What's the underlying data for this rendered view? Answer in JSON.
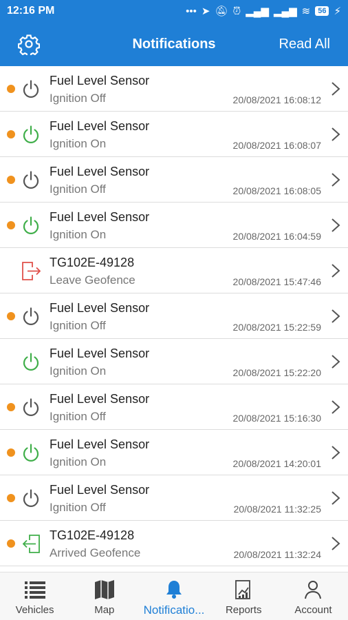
{
  "status_bar": {
    "time": "12:16 PM",
    "icons": [
      "more-dots-icon",
      "location-icon",
      "mute-icon",
      "alarm-icon",
      "signal-icon",
      "signal-icon",
      "wifi-icon"
    ],
    "battery": "56",
    "charging": "⚡"
  },
  "header": {
    "title": "Notifications",
    "action": "Read All"
  },
  "notifications": [
    {
      "unread": true,
      "type": "ignition-off",
      "title": "Fuel Level Sensor",
      "subtitle": "Ignition Off",
      "time": "20/08/2021 16:08:12"
    },
    {
      "unread": true,
      "type": "ignition-on",
      "title": "Fuel Level Sensor",
      "subtitle": "Ignition On",
      "time": "20/08/2021 16:08:07"
    },
    {
      "unread": true,
      "type": "ignition-off",
      "title": "Fuel Level Sensor",
      "subtitle": "Ignition Off",
      "time": "20/08/2021 16:08:05"
    },
    {
      "unread": true,
      "type": "ignition-on",
      "title": "Fuel Level Sensor",
      "subtitle": "Ignition On",
      "time": "20/08/2021 16:04:59"
    },
    {
      "unread": false,
      "type": "leave-geofence",
      "title": "TG102E-49128",
      "subtitle": "Leave Geofence",
      "time": "20/08/2021 15:47:46"
    },
    {
      "unread": true,
      "type": "ignition-off",
      "title": "Fuel Level Sensor",
      "subtitle": "Ignition Off",
      "time": "20/08/2021 15:22:59"
    },
    {
      "unread": false,
      "type": "ignition-on",
      "title": "Fuel Level Sensor",
      "subtitle": "Ignition On",
      "time": "20/08/2021 15:22:20"
    },
    {
      "unread": true,
      "type": "ignition-off",
      "title": "Fuel Level Sensor",
      "subtitle": "Ignition Off",
      "time": "20/08/2021 15:16:30"
    },
    {
      "unread": true,
      "type": "ignition-on",
      "title": "Fuel Level Sensor",
      "subtitle": "Ignition On",
      "time": "20/08/2021 14:20:01"
    },
    {
      "unread": true,
      "type": "ignition-off",
      "title": "Fuel Level Sensor",
      "subtitle": "Ignition Off",
      "time": "20/08/2021 11:32:25"
    },
    {
      "unread": true,
      "type": "arrive-geofence",
      "title": "TG102E-49128",
      "subtitle": "Arrived Geofence",
      "time": "20/08/2021 11:32:24"
    }
  ],
  "tabs": [
    {
      "label": "Vehicles",
      "icon": "list-icon",
      "active": false
    },
    {
      "label": "Map",
      "icon": "map-icon",
      "active": false
    },
    {
      "label": "Notificatio...",
      "icon": "bell-icon",
      "active": true
    },
    {
      "label": "Reports",
      "icon": "reports-icon",
      "active": false
    },
    {
      "label": "Account",
      "icon": "account-icon",
      "active": false
    }
  ],
  "colors": {
    "primary": "#1f7fd6",
    "unread_dot": "#f0921e",
    "ignition_on": "#3fae49",
    "ignition_off": "#555555",
    "leave_geofence": "#e0504a",
    "arrive_geofence": "#3fae49"
  }
}
